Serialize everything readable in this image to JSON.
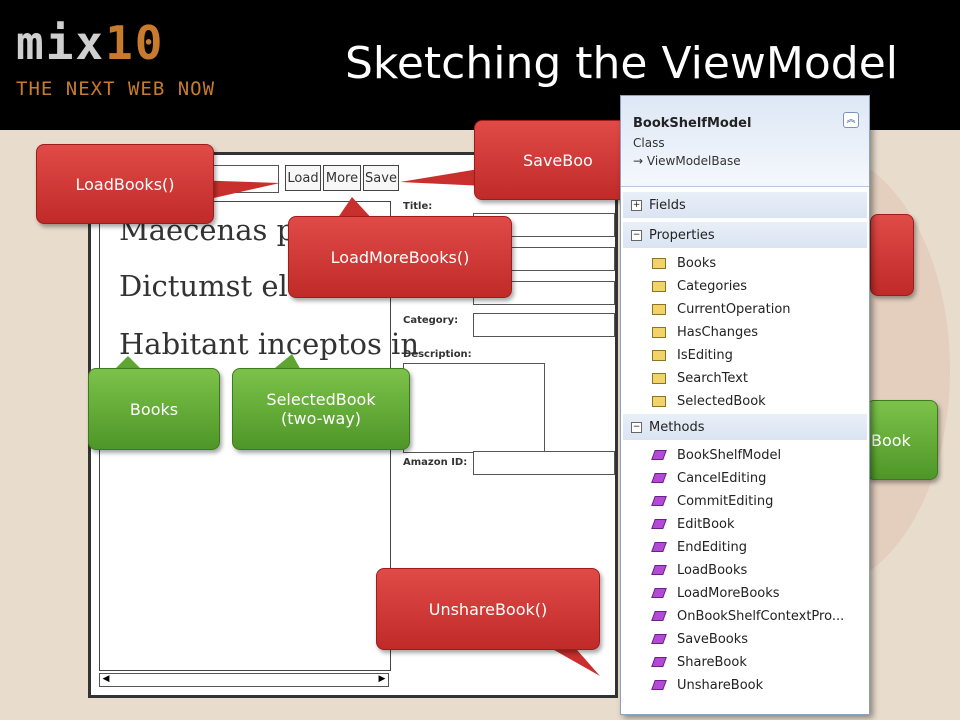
{
  "header": {
    "logo_mix": "mix",
    "logo_ten": "10",
    "logo_tagline": "THE NEXT WEB NOW",
    "title": "Sketching the ViewModel"
  },
  "mockup": {
    "buttons": {
      "load": "Load",
      "more": "More",
      "save": "Save"
    },
    "list_items": [
      "Maecenas pra",
      "Dictumst eleifen",
      "Habitant inceptos in"
    ],
    "form_labels": {
      "title": "Title:",
      "category": "Category:",
      "description": "Description:",
      "amazon_id": "Amazon ID:"
    }
  },
  "callouts": {
    "load_books": "LoadBooks()",
    "load_more_books": "LoadMoreBooks()",
    "save_books": "SaveBoo",
    "books": "Books",
    "selected_book_line1": "SelectedBook",
    "selected_book_line2": "(two-way)",
    "share_book": "Book",
    "unshare_book": "UnshareBook()"
  },
  "class_diagram": {
    "name": "BookShelfModel",
    "kind": "Class",
    "base": "ViewModelBase",
    "sections": {
      "fields": "Fields",
      "properties": "Properties",
      "methods": "Methods"
    },
    "properties": [
      "Books",
      "Categories",
      "CurrentOperation",
      "HasChanges",
      "IsEditing",
      "SearchText",
      "SelectedBook"
    ],
    "methods": [
      "BookShelfModel",
      "CancelEditing",
      "CommitEditing",
      "EditBook",
      "EndEditing",
      "LoadBooks",
      "LoadMoreBooks",
      "OnBookShelfContextPro...",
      "SaveBooks",
      "ShareBook",
      "UnshareBook"
    ]
  }
}
